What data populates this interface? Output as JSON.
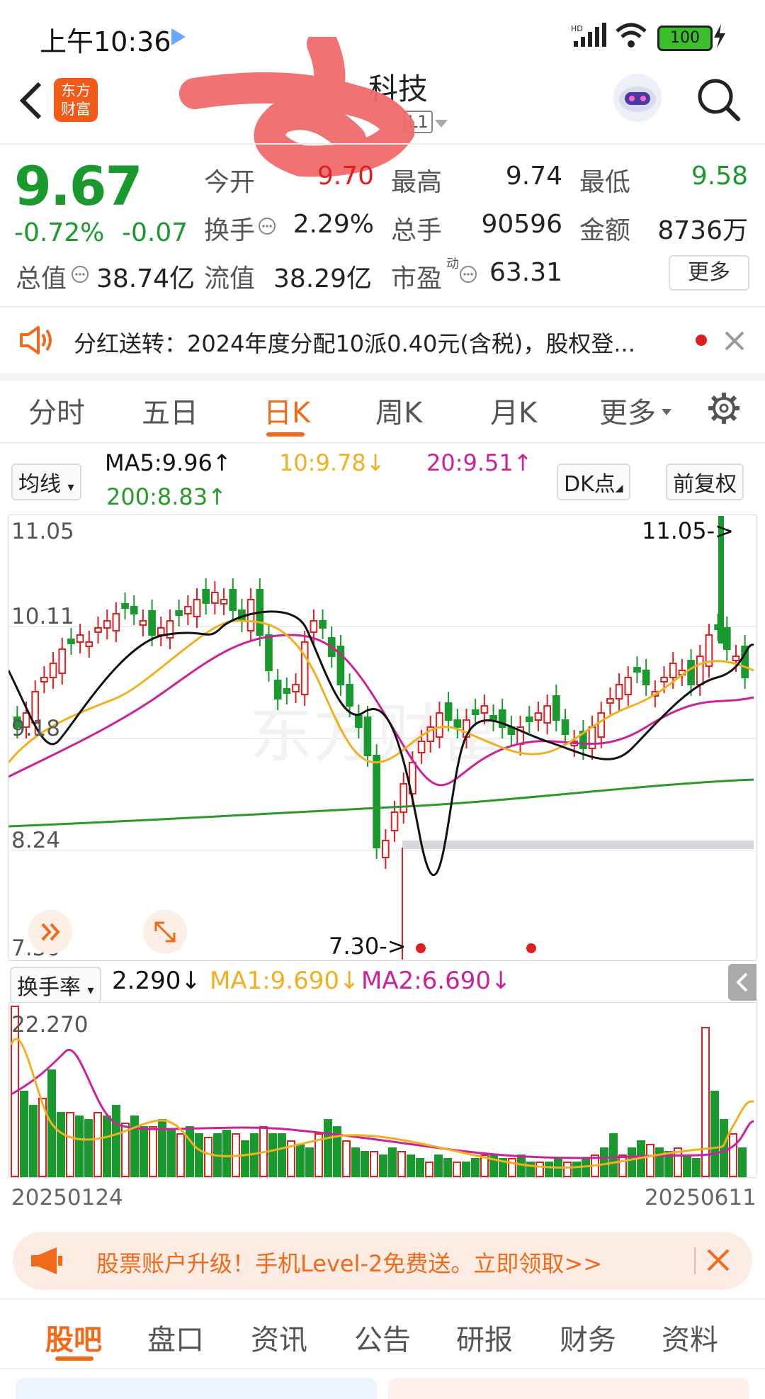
{
  "status_bar": {
    "time": "上午10:36",
    "battery": "100"
  },
  "header": {
    "title": "科技",
    "level_badge": "L1",
    "app_logo_line1": "东方",
    "app_logo_line2": "财富"
  },
  "quote": {
    "price": "9.67",
    "change_pct": "-0.72%",
    "change_abs": "-0.07",
    "open_label": "今开",
    "open": "9.70",
    "high_label": "最高",
    "high": "9.74",
    "low_label": "最低",
    "low": "9.58",
    "turnover_label": "换手",
    "turnover": "2.29%",
    "volume_label": "总手",
    "volume": "90596",
    "amount_label": "金额",
    "amount": "8736万",
    "mktcap_label": "总值",
    "mktcap": "38.74亿",
    "float_label": "流值",
    "float_cap": "38.29亿",
    "pe_label": "市盈",
    "pe_sup": "动",
    "pe": "63.31",
    "more_button": "更多"
  },
  "notice": {
    "text": "分红送转：2024年度分配10派0.40元(含税)，股权登..."
  },
  "chart_tabs": [
    "分时",
    "五日",
    "日K",
    "周K",
    "月K",
    "更多"
  ],
  "active_chart_tab": 2,
  "ma_bar": {
    "select": "均线",
    "ma5": "MA5:9.96↑",
    "ma10": "10:9.78↓",
    "ma20": "20:9.51↑",
    "ma200": "200:8.83↑",
    "dk_button": "DK点",
    "adjust_button": "前复权"
  },
  "kline": {
    "y_labels": [
      "11.05",
      "10.11",
      "9.18",
      "8.24",
      "7.30"
    ],
    "high_marker": "11.05->",
    "low_marker": "7.30->"
  },
  "turnover_bar": {
    "select": "换手率",
    "value": "2.290↓",
    "ma1": "MA1:9.690↓",
    "ma2": "MA2:6.690↓",
    "max_label": "22.270"
  },
  "date_range": {
    "start": "20250124",
    "end": "20250611"
  },
  "promo": {
    "text": "股票账户升级！手机Level-2免费送。立即领取>>"
  },
  "bottom_tabs": [
    "股吧",
    "盘口",
    "资讯",
    "公告",
    "研报",
    "财务",
    "资料"
  ],
  "colors": {
    "up": "#e02020",
    "down": "#1a9a2e",
    "accent": "#f06a1a",
    "ma5": "#111111",
    "ma10": "#f0b020",
    "ma20": "#cc2299",
    "ma200": "#2a9a2a"
  }
}
